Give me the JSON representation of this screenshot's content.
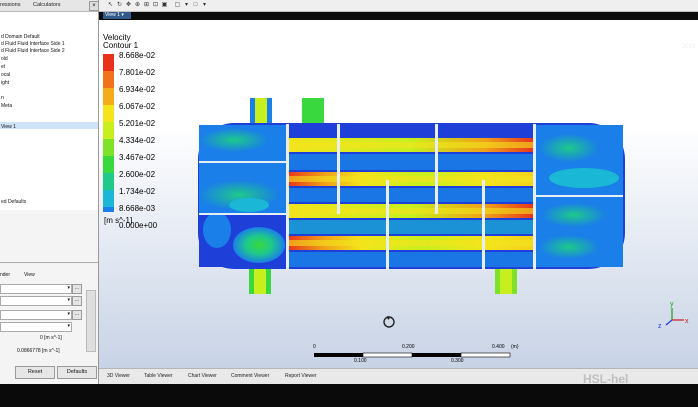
{
  "left_panel": {
    "tabs": [
      "ressions",
      "Calculators"
    ],
    "close_glyph": "×",
    "tree_items": [
      "d Domain Default",
      "d Fluid Fluid Interface Side 1",
      "d Fluid Fluid Interface Side 2",
      "old",
      "et",
      "ocal",
      "ight",
      "n",
      "Meta",
      "View 1",
      "ed Defaults"
    ],
    "details_tabs": [
      "nder",
      "View"
    ],
    "values": [
      "0 [m s^-1]",
      "0.0866778 [m s^-1]"
    ],
    "buttons": {
      "reset": "Reset",
      "defaults": "Defaults"
    },
    "dots": "..."
  },
  "toolbar": {
    "view_selector": "View 1",
    "arrow": "▾"
  },
  "viewer": {
    "brand": "ANSY",
    "brand_year": "2019",
    "legend": {
      "title": "Velocity",
      "subtitle": "Contour 1",
      "unit": "[m s^-1]",
      "labels": [
        "8.668e-02",
        "7.801e-02",
        "6.934e-02",
        "6.067e-02",
        "5.201e-02",
        "4.334e-02",
        "3.467e-02",
        "2.600e-02",
        "1.734e-02",
        "8.668e-03",
        "0.000e+00"
      ],
      "colors": [
        "#e8321c",
        "#f0721a",
        "#f3ad18",
        "#f3e41c",
        "#c7ef1e",
        "#7ee22a",
        "#38d83e",
        "#1ec98a",
        "#1ab7d6",
        "#1a7fe8",
        "#1e3fd8"
      ]
    },
    "scale": {
      "labels_top": [
        "0",
        "0.200",
        "0.400",
        "(m)"
      ],
      "labels_bottom": [
        "0.100",
        "0.300"
      ]
    }
  },
  "bottom_tabs": [
    "3D Viewer",
    "Table Viewer",
    "Chart Viewer",
    "Comment Viewer",
    "Report Viewer"
  ],
  "watermark": "HSL-hel"
}
